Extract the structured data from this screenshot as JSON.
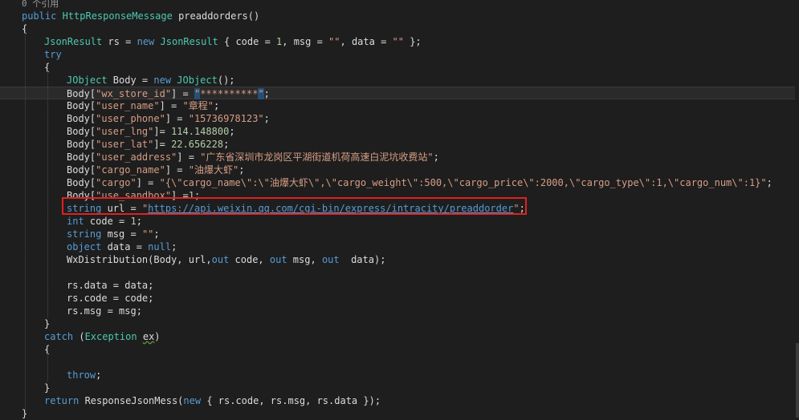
{
  "editor": {
    "lines": [
      {
        "segs": [
          {
            "c": "ref",
            "t": "0 个引用"
          }
        ],
        "indent": 27
      },
      {
        "segs": [
          {
            "c": "kw",
            "t": "public "
          },
          {
            "c": "ty",
            "t": "HttpResponseMessage"
          },
          {
            "c": "def",
            "t": " preaddorders()"
          }
        ],
        "indent": 27
      },
      {
        "segs": [
          {
            "c": "def",
            "t": "{"
          }
        ],
        "indent": 27
      },
      {
        "segs": [
          {
            "c": "ty",
            "t": "JsonResult"
          },
          {
            "c": "def",
            "t": " rs = "
          },
          {
            "c": "kw",
            "t": "new "
          },
          {
            "c": "ty",
            "t": "JsonResult"
          },
          {
            "c": "def",
            "t": " { code = "
          },
          {
            "c": "num",
            "t": "1"
          },
          {
            "c": "def",
            "t": ", msg = "
          },
          {
            "c": "str",
            "t": "\"\""
          },
          {
            "c": "def",
            "t": ", data = "
          },
          {
            "c": "str",
            "t": "\"\""
          },
          {
            "c": "def",
            "t": " };"
          }
        ],
        "indent": 55
      },
      {
        "segs": [
          {
            "c": "kw",
            "t": "try"
          }
        ],
        "indent": 55
      },
      {
        "segs": [
          {
            "c": "def",
            "t": "{"
          }
        ],
        "indent": 55
      },
      {
        "segs": [
          {
            "c": "ty",
            "t": "JObject"
          },
          {
            "c": "def",
            "t": " Body = "
          },
          {
            "c": "kw",
            "t": "new "
          },
          {
            "c": "ty",
            "t": "JObject"
          },
          {
            "c": "def",
            "t": "();"
          }
        ],
        "indent": 83
      },
      {
        "segs": [
          {
            "c": "def",
            "t": "Body["
          },
          {
            "c": "str",
            "t": "\"wx_store_id\""
          },
          {
            "c": "def",
            "t": "] = "
          },
          {
            "c": "sel",
            "t": "\""
          },
          {
            "c": "str",
            "t": "**********"
          },
          {
            "c": "sel",
            "t": "\""
          },
          {
            "c": "def",
            "t": ";"
          }
        ],
        "indent": 83,
        "hl": true
      },
      {
        "segs": [
          {
            "c": "def",
            "t": "Body["
          },
          {
            "c": "str",
            "t": "\"user_name\""
          },
          {
            "c": "def",
            "t": "] = "
          },
          {
            "c": "str",
            "t": "\"章程\""
          },
          {
            "c": "def",
            "t": ";"
          }
        ],
        "indent": 83
      },
      {
        "segs": [
          {
            "c": "def",
            "t": "Body["
          },
          {
            "c": "str",
            "t": "\"user_phone\""
          },
          {
            "c": "def",
            "t": "] = "
          },
          {
            "c": "str",
            "t": "\"15736978123\""
          },
          {
            "c": "def",
            "t": ";"
          }
        ],
        "indent": 83
      },
      {
        "segs": [
          {
            "c": "def",
            "t": "Body["
          },
          {
            "c": "str",
            "t": "\"user_lng\""
          },
          {
            "c": "def",
            "t": "]= "
          },
          {
            "c": "num",
            "t": "114.148800"
          },
          {
            "c": "def",
            "t": ";"
          }
        ],
        "indent": 83
      },
      {
        "segs": [
          {
            "c": "def",
            "t": "Body["
          },
          {
            "c": "str",
            "t": "\"user_lat\""
          },
          {
            "c": "def",
            "t": "]= "
          },
          {
            "c": "num",
            "t": "22.656228"
          },
          {
            "c": "def",
            "t": ";"
          }
        ],
        "indent": 83
      },
      {
        "segs": [
          {
            "c": "def",
            "t": "Body["
          },
          {
            "c": "str",
            "t": "\"user_address\""
          },
          {
            "c": "def",
            "t": "] = "
          },
          {
            "c": "str",
            "t": "\"广东省深圳市龙岗区平湖街道机荷高速白泥坑收费站\""
          },
          {
            "c": "def",
            "t": ";"
          }
        ],
        "indent": 83
      },
      {
        "segs": [
          {
            "c": "def",
            "t": "Body["
          },
          {
            "c": "str",
            "t": "\"cargo_name\""
          },
          {
            "c": "def",
            "t": "] = "
          },
          {
            "c": "str",
            "t": "\"油爆大虾\""
          },
          {
            "c": "def",
            "t": ";"
          }
        ],
        "indent": 83
      },
      {
        "segs": [
          {
            "c": "def",
            "t": "Body["
          },
          {
            "c": "str",
            "t": "\"cargo\""
          },
          {
            "c": "def",
            "t": "] = "
          },
          {
            "c": "str",
            "t": "\"{\\\"cargo_name\\\":\\\"油爆大虾\\\",\\\"cargo_weight\\\":500,\\\"cargo_price\\\":2000,\\\"cargo_type\\\":1,\\\"cargo_num\\\":1}\""
          },
          {
            "c": "def",
            "t": ";"
          }
        ],
        "indent": 83
      },
      {
        "segs": [
          {
            "c": "def",
            "t": "Body["
          },
          {
            "c": "str",
            "t": "\"use_sandbox\""
          },
          {
            "c": "def",
            "t": "] ="
          },
          {
            "c": "num",
            "t": "1"
          },
          {
            "c": "def",
            "t": ";"
          }
        ],
        "indent": 83
      },
      {
        "segs": [
          {
            "c": "kw",
            "t": "string"
          },
          {
            "c": "def",
            "t": " url = "
          },
          {
            "c": "str",
            "t": "\""
          },
          {
            "c": "link",
            "t": "https://api.weixin.qq.com/cgi-bin/express/intracity/preaddorder"
          },
          {
            "c": "str",
            "t": "\""
          },
          {
            "c": "def",
            "t": ";"
          }
        ],
        "indent": 83
      },
      {
        "segs": [
          {
            "c": "kw",
            "t": "int"
          },
          {
            "c": "def",
            "t": " code = "
          },
          {
            "c": "num",
            "t": "1"
          },
          {
            "c": "def",
            "t": ";"
          }
        ],
        "indent": 83
      },
      {
        "segs": [
          {
            "c": "kw",
            "t": "string"
          },
          {
            "c": "def",
            "t": " msg = "
          },
          {
            "c": "str",
            "t": "\"\""
          },
          {
            "c": "def",
            "t": ";"
          }
        ],
        "indent": 83
      },
      {
        "segs": [
          {
            "c": "kw",
            "t": "object"
          },
          {
            "c": "def",
            "t": " data = "
          },
          {
            "c": "kw",
            "t": "null"
          },
          {
            "c": "def",
            "t": ";"
          }
        ],
        "indent": 83
      },
      {
        "segs": [
          {
            "c": "def",
            "t": "WxDistribution(Body, url,"
          },
          {
            "c": "kw",
            "t": "out"
          },
          {
            "c": "def",
            "t": " code, "
          },
          {
            "c": "kw",
            "t": "out"
          },
          {
            "c": "def",
            "t": " msg, "
          },
          {
            "c": "kw",
            "t": "out"
          },
          {
            "c": "def",
            "t": "  data);"
          }
        ],
        "indent": 83
      },
      {
        "segs": [],
        "indent": 83
      },
      {
        "segs": [
          {
            "c": "def",
            "t": "rs.data = data;"
          }
        ],
        "indent": 83
      },
      {
        "segs": [
          {
            "c": "def",
            "t": "rs.code = code;"
          }
        ],
        "indent": 83
      },
      {
        "segs": [
          {
            "c": "def",
            "t": "rs.msg = msg;"
          }
        ],
        "indent": 83
      },
      {
        "segs": [
          {
            "c": "def",
            "t": "}"
          }
        ],
        "indent": 55
      },
      {
        "segs": [
          {
            "c": "kw",
            "t": "catch"
          },
          {
            "c": "def",
            "t": " ("
          },
          {
            "c": "ty",
            "t": "Exception"
          },
          {
            "c": "def",
            "t": " "
          },
          {
            "c": "squig",
            "t": "ex"
          },
          {
            "c": "def",
            "t": ")"
          }
        ],
        "indent": 55
      },
      {
        "segs": [
          {
            "c": "def",
            "t": "{"
          }
        ],
        "indent": 55
      },
      {
        "segs": [],
        "indent": 83
      },
      {
        "segs": [
          {
            "c": "kw",
            "t": "throw"
          },
          {
            "c": "def",
            "t": ";"
          }
        ],
        "indent": 83
      },
      {
        "segs": [
          {
            "c": "def",
            "t": "}"
          }
        ],
        "indent": 55
      },
      {
        "segs": [
          {
            "c": "kw",
            "t": "return"
          },
          {
            "c": "def",
            "t": " ResponseJsonMess("
          },
          {
            "c": "kw",
            "t": "new"
          },
          {
            "c": "def",
            "t": " { rs.code, rs.msg, rs.data });"
          }
        ],
        "indent": 55
      },
      {
        "segs": [
          {
            "c": "def",
            "t": "}"
          }
        ],
        "indent": 27
      }
    ]
  }
}
